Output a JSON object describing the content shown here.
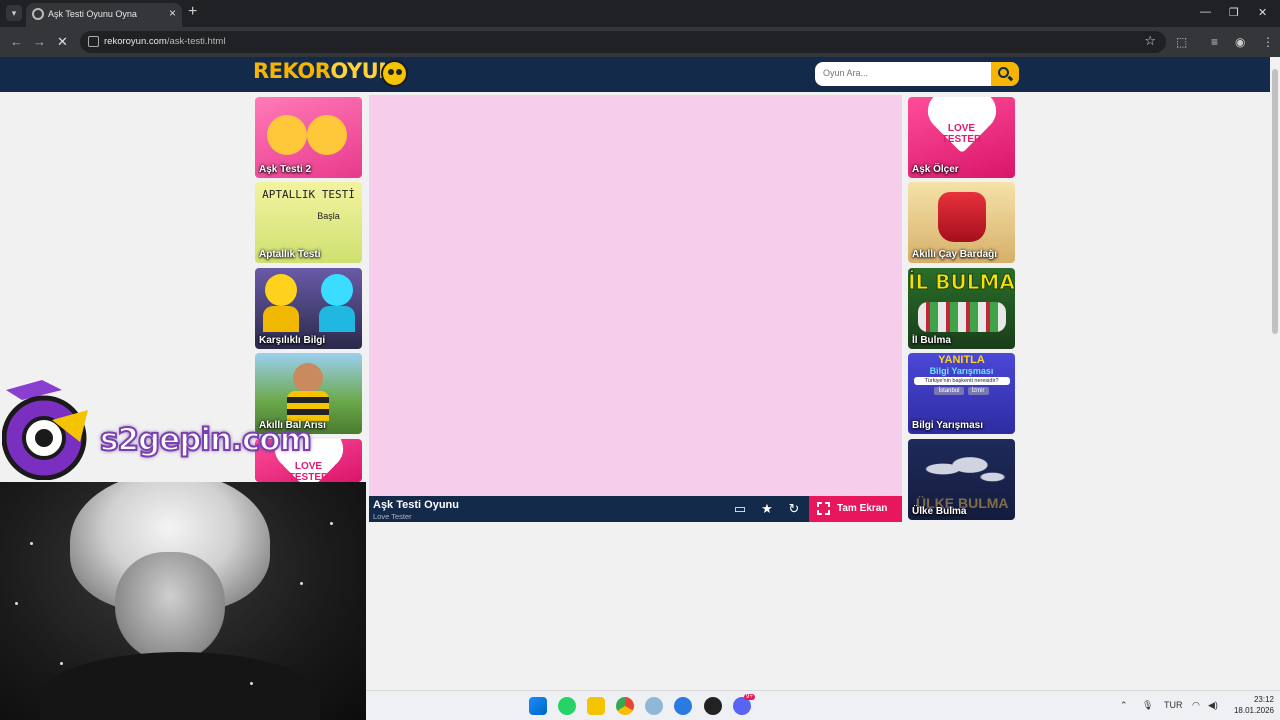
{
  "browser": {
    "tab_title": "Aşk Testi Oyunu Oyna",
    "url_host": "rekoroyun.com",
    "url_path": "/ask-testi.html"
  },
  "site": {
    "logo_part1": "REKOR",
    "logo_part2": "OYUN",
    "search_placeholder": "Oyun Ara..."
  },
  "left_games": [
    {
      "label": "Aşk Testi 2"
    },
    {
      "label": "Aptallık Testi",
      "art_text": "APTALLIK TESTİ",
      "art_sub": "Başla"
    },
    {
      "label": "Karşılıklı Bilgi"
    },
    {
      "label": "Akıllı Bal Arısı"
    },
    {
      "label": "",
      "art_text": "LOVE TESTER"
    }
  ],
  "right_games": [
    {
      "label": "Aşk Ölçer",
      "art_text": "LOVE TESTER"
    },
    {
      "label": "Akıllı Çay Bardağı"
    },
    {
      "label": "İl Bulma",
      "art_text": "İL BULMA"
    },
    {
      "label": "Bilgi Yarışması",
      "art_text": "YANITLA",
      "art_sub": "Bilgi Yarışması",
      "question": "Türkiye'nin başkenti neresidir?",
      "opt1": "İstanbul",
      "opt2": "İzmir"
    },
    {
      "label": "Ülke Bulma",
      "art_text": "ÜLKE BULMA"
    }
  ],
  "game": {
    "title": "Aşk Testi Oyunu",
    "subtitle": "Love Tester",
    "fullscreen_label": "Tam Ekran"
  },
  "overlay": {
    "watermark": "s2gepin.com"
  },
  "taskbar": {
    "lang": "TUR",
    "time": "23:12",
    "date": "18.01.2026",
    "badge": "9+"
  },
  "colors": {
    "header": "#142a4a",
    "game_bg": "#f7cdec",
    "accent": "#e8175d",
    "search_btn": "#f5b500"
  }
}
